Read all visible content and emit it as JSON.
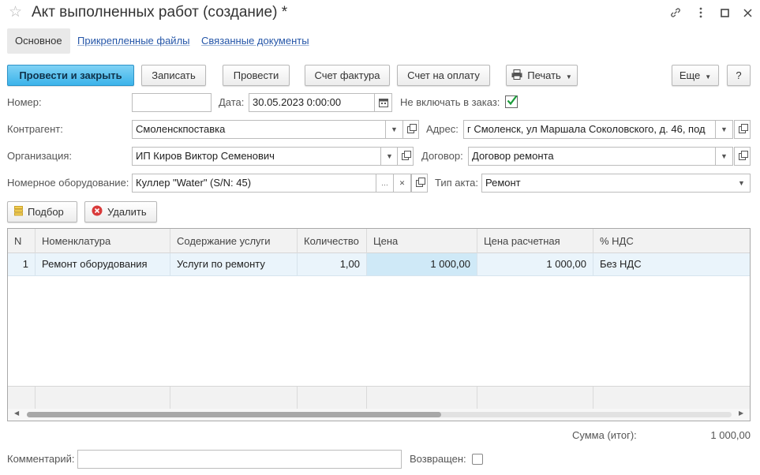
{
  "window": {
    "title": "Акт выполненных работ (создание) *"
  },
  "tabs": [
    {
      "label": "Основное"
    },
    {
      "label": "Прикрепленные файлы"
    },
    {
      "label": "Связанные документы"
    }
  ],
  "toolbar": {
    "post_close": "Провести и закрыть",
    "save": "Записать",
    "post": "Провести",
    "invoice": "Счет фактура",
    "payment_invoice": "Счет на оплату",
    "print": "Печать",
    "more": "Еще",
    "help": "?"
  },
  "form": {
    "number_label": "Номер:",
    "number_value": "",
    "date_label": "Дата:",
    "date_value": "30.05.2023  0:00:00",
    "exclude_label": "Не включать в заказ:",
    "exclude_checked": true,
    "counterparty_label": "Контрагент:",
    "counterparty_value": "Смоленскпоставка",
    "address_label": "Адрес:",
    "address_value": "г Смоленск,  ул Маршала Соколовского,  д. 46,  под",
    "organization_label": "Организация:",
    "organization_value": "ИП Киров Виктор Семенович",
    "contract_label": "Договор:",
    "contract_value": "Договор ремонта",
    "equipment_label": "Номерное оборудование:",
    "equipment_value": "Куллер \"Water\" (S/N: 45)",
    "act_type_label": "Тип акта:",
    "act_type_value": "Ремонт",
    "comment_label": "Комментарий:",
    "comment_value": "",
    "returned_label": "Возвращен:",
    "returned_checked": false
  },
  "table_toolbar": {
    "select": "Подбор",
    "delete": "Удалить"
  },
  "table": {
    "columns": [
      "N",
      "Номенклатура",
      "Содержание услуги",
      "Количество",
      "Цена",
      "Цена расчетная",
      "% НДС"
    ],
    "rows": [
      {
        "n": "1",
        "item": "Ремонт оборудования",
        "service": "Услуги по ремонту",
        "qty": "1,00",
        "price": "1 000,00",
        "calc_price": "1 000,00",
        "vat": "Без НДС"
      }
    ]
  },
  "totals": {
    "label": "Сумма (итог):",
    "value": "1 000,00"
  },
  "colors": {
    "accent": "#3bb3ea",
    "link": "#2556a8",
    "check": "#1a9c3a",
    "delete_icon": "#d93a3a",
    "select_icon": "#e0b12a"
  },
  "icons": [
    "star-icon",
    "link-icon",
    "more-vert-icon",
    "maximize-icon",
    "close-icon",
    "printer-icon",
    "calendar-icon",
    "dropdown-icon",
    "open-icon",
    "clear-icon",
    "ellipsis-icon",
    "select-icon",
    "delete-icon"
  ]
}
